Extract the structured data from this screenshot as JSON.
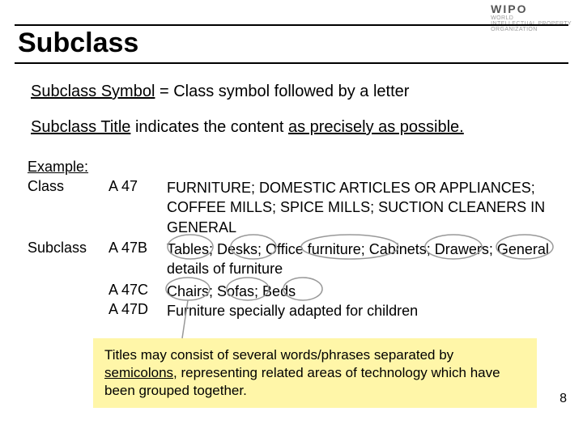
{
  "logo": {
    "main": "WIPO",
    "line1": "WORLD",
    "line2": "INTELLECTUAL PROPERTY",
    "line3": "ORGANIZATION"
  },
  "title": "Subclass",
  "def1": {
    "prefix": "Subclass Symbol",
    "rest": " = Class symbol followed by a letter"
  },
  "def2": {
    "prefix": "Subclass Title",
    "middle": " indicates the content ",
    "suffix": "as precisely as possible."
  },
  "example": {
    "label": "Example:",
    "rows": [
      {
        "label": "Class",
        "code": "A 47",
        "desc": "FURNITURE; DOMESTIC ARTICLES OR APPLIANCES; COFFEE MILLS; SPICE MILLS; SUCTION CLEANERS IN GENERAL"
      },
      {
        "label": "Subclass",
        "code": "A 47B",
        "desc": "Tables; Desks; Office furniture; Cabinets; Drawers; General details of furniture"
      },
      {
        "label": "",
        "code": "A 47C",
        "desc": "Chairs; Sofas; Beds"
      },
      {
        "label": "",
        "code": "A 47D",
        "desc": "Furniture specially adapted for children"
      }
    ]
  },
  "note": {
    "pre": "Titles may consist of several words/phrases separated by ",
    "keyword": "semicolons",
    "post": ", representing related areas of technology which have been grouped together."
  },
  "page_number": "8"
}
